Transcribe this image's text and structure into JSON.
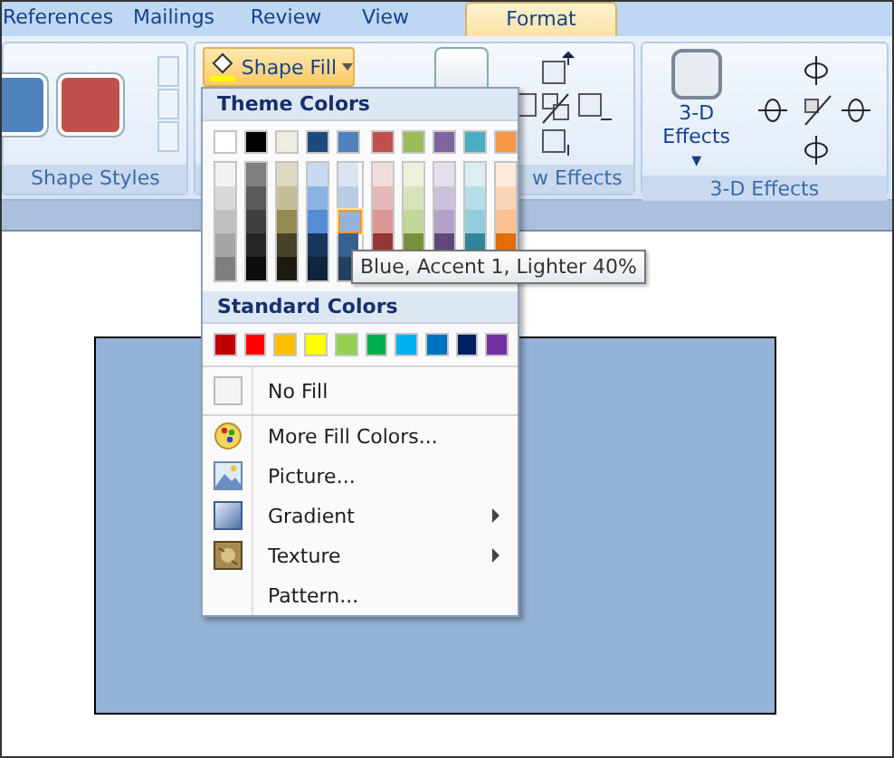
{
  "tabs": [
    {
      "label": "References",
      "selected": false
    },
    {
      "label": "Mailings",
      "selected": false
    },
    {
      "label": "Review",
      "selected": false
    },
    {
      "label": "View",
      "selected": false
    },
    {
      "label": "Format",
      "selected": true
    }
  ],
  "ribbon": {
    "groups": [
      {
        "kind": "styles",
        "label": "Shape Styles",
        "styles": [
          {
            "color": "#4f81bd"
          },
          {
            "color": "#c0504d"
          }
        ]
      },
      {
        "kind": "shadow",
        "label": "w Effects",
        "button": "Shape Fill"
      },
      {
        "kind": "threed",
        "label": "3-D Effects",
        "button": "3-D Effects",
        "caret": "▾"
      }
    ]
  },
  "menu": {
    "theme_title": "Theme Colors",
    "theme_columns": [
      [
        {
          "color": "#ffffff",
          "selected": false
        },
        {
          "color": "#f2f2f2",
          "selected": false
        },
        {
          "color": "#d8d8d8",
          "selected": false
        },
        {
          "color": "#bfbfbf",
          "selected": false
        },
        {
          "color": "#a5a5a5",
          "selected": false
        },
        {
          "color": "#7f7f7f",
          "selected": false
        }
      ],
      [
        {
          "color": "#000000",
          "selected": false
        },
        {
          "color": "#7f7f7f",
          "selected": false
        },
        {
          "color": "#595959",
          "selected": false
        },
        {
          "color": "#3f3f3f",
          "selected": false
        },
        {
          "color": "#262626",
          "selected": false
        },
        {
          "color": "#0c0c0c",
          "selected": false
        }
      ],
      [
        {
          "color": "#eeece1",
          "selected": false
        },
        {
          "color": "#ddd9c3",
          "selected": false
        },
        {
          "color": "#c4bd97",
          "selected": false
        },
        {
          "color": "#938953",
          "selected": false
        },
        {
          "color": "#494429",
          "selected": false
        },
        {
          "color": "#1d1b10",
          "selected": false
        }
      ],
      [
        {
          "color": "#1f497d",
          "selected": false
        },
        {
          "color": "#c6d9f0",
          "selected": false
        },
        {
          "color": "#8db3e2",
          "selected": false
        },
        {
          "color": "#548dd4",
          "selected": false
        },
        {
          "color": "#17365d",
          "selected": false
        },
        {
          "color": "#0f243e",
          "selected": false
        }
      ],
      [
        {
          "color": "#4f81bd",
          "selected": false
        },
        {
          "color": "#dbe5f1",
          "selected": false
        },
        {
          "color": "#b8cce4",
          "selected": false
        },
        {
          "color": "#95b3d7",
          "selected": true
        },
        {
          "color": "#366092",
          "selected": false
        },
        {
          "color": "#244061",
          "selected": false
        }
      ],
      [
        {
          "color": "#c0504d",
          "selected": false
        },
        {
          "color": "#f2dcdb",
          "selected": false
        },
        {
          "color": "#e5b9b7",
          "selected": false
        },
        {
          "color": "#d99694",
          "selected": false
        },
        {
          "color": "#953734",
          "selected": false
        }
      ],
      [
        {
          "color": "#9bbb59",
          "selected": false
        },
        {
          "color": "#ebf1dd",
          "selected": false
        },
        {
          "color": "#d7e3bc",
          "selected": false
        },
        {
          "color": "#c3d69b",
          "selected": false
        },
        {
          "color": "#76923c",
          "selected": false
        }
      ],
      [
        {
          "color": "#8064a2",
          "selected": false
        },
        {
          "color": "#e5e0ec",
          "selected": false
        },
        {
          "color": "#ccc1d9",
          "selected": false
        },
        {
          "color": "#b2a2c7",
          "selected": false
        },
        {
          "color": "#5f497a",
          "selected": false
        }
      ],
      [
        {
          "color": "#4bacc6",
          "selected": false
        },
        {
          "color": "#dbeef3",
          "selected": false
        },
        {
          "color": "#b7dde8",
          "selected": false
        },
        {
          "color": "#92cddc",
          "selected": false
        },
        {
          "color": "#31859b",
          "selected": false
        }
      ],
      [
        {
          "color": "#f79646",
          "selected": false
        },
        {
          "color": "#fdeada",
          "selected": false
        },
        {
          "color": "#fbd5b5",
          "selected": false
        },
        {
          "color": "#fac08f",
          "selected": false
        },
        {
          "color": "#e36c09",
          "selected": false
        }
      ]
    ],
    "standard_title": "Standard Colors",
    "standard_colors": [
      {
        "color": "#c00000",
        "selected": false
      },
      {
        "color": "#ff0000",
        "selected": false
      },
      {
        "color": "#ffc000",
        "selected": false
      },
      {
        "color": "#ffff00",
        "selected": false
      },
      {
        "color": "#92d050",
        "selected": false
      },
      {
        "color": "#00b050",
        "selected": false
      },
      {
        "color": "#00b0f0",
        "selected": false
      },
      {
        "color": "#0070c0",
        "selected": false
      },
      {
        "color": "#002060",
        "selected": false
      },
      {
        "color": "#7030a0",
        "selected": false
      }
    ],
    "items": [
      {
        "kind": "nofill",
        "label": "No Fill",
        "submenu": false
      },
      {
        "kind": "palette",
        "label": "More Fill Colors...",
        "submenu": false
      },
      {
        "kind": "picture",
        "label": "Picture...",
        "submenu": false
      },
      {
        "kind": "gradient",
        "label": "Gradient",
        "submenu": true
      },
      {
        "kind": "texture",
        "label": "Texture",
        "submenu": true
      },
      {
        "kind": "none",
        "label": "Pattern...",
        "submenu": false
      }
    ]
  },
  "tooltip": "Blue, Accent 1, Lighter 40%",
  "document": {
    "shape": {
      "color": "#95b3d7"
    }
  }
}
